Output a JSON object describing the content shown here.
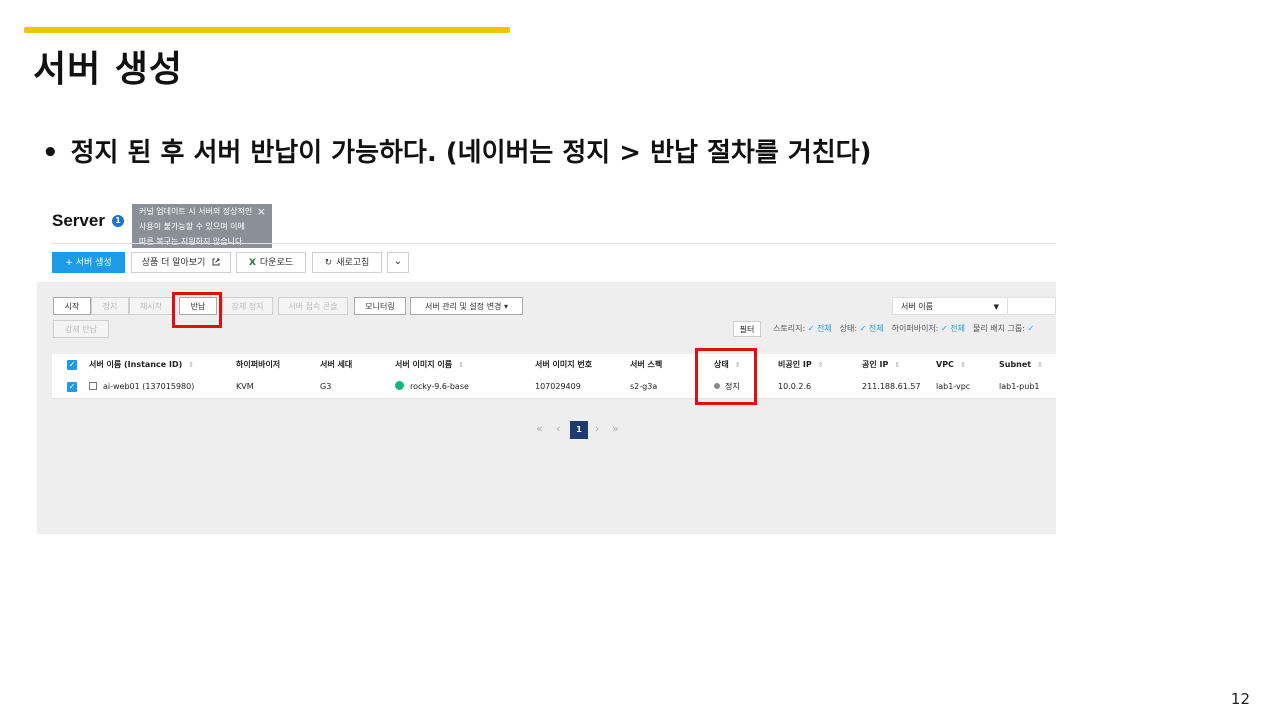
{
  "slide": {
    "title": "서버 생성",
    "bullet": "정지 된 후 서버 반납이 가능하다.  (네이버는 정지 > 반납 절차를 거친다)",
    "bullet_marker": "•",
    "page_number": "12",
    "accent_color": "#f5c400"
  },
  "console": {
    "title": "Server",
    "info_badge": "1",
    "tooltip": {
      "lines": [
        "커널 업데이트 시 서버의 정상적인",
        "사용이 불가능할 수 있으며 이에",
        "따른 복구는 지원하지 않습니다."
      ],
      "close": "×"
    },
    "toolbar": {
      "create": "+  서버 생성",
      "learn_more": "상품 더 알아보기",
      "learn_more_icon": "external-link-icon",
      "download_icon_text": "X",
      "download": "다운로드",
      "refresh_icon_text": "↻",
      "refresh": "새로고침",
      "more": "⌄"
    },
    "actions": {
      "start": "시작",
      "stop": "정지",
      "restart": "재시작",
      "return": "반납",
      "force_stop": "강제 정지",
      "connect_console": "서버 접속 콘솔",
      "monitoring": "모니터링",
      "manage": "서버 관리 및 설정 변경  ▾",
      "force_return": "강제 반납"
    },
    "search": {
      "select_label": "서버 이름",
      "caret": "▼"
    },
    "filter": {
      "button": "필터",
      "storage_label": "스토리지:",
      "storage_value": "전체",
      "status_label": "상태:",
      "status_value": "전체",
      "hypervisor_label": "하이퍼바이저:",
      "hypervisor_value": "전체",
      "placement_label": "물리 배치 그룹:",
      "check": "✓"
    },
    "table": {
      "headers": {
        "name": "서버 이름 (Instance ID)",
        "hypervisor": "하이퍼바이저",
        "generation": "서버 세대",
        "image_name": "서버 이미지 이름",
        "image_no": "서버 이미지 번호",
        "spec": "서버 스펙",
        "status": "상태",
        "private_ip": "비공인 IP",
        "public_ip": "공인 IP",
        "vpc": "VPC",
        "subnet": "Subnet"
      },
      "sort_glyph": "⇕",
      "rows": [
        {
          "name": "ai-web01 (137015980)",
          "hypervisor": "KVM",
          "generation": "G3",
          "image_name": "rocky-9.6-base",
          "image_no": "107029409",
          "spec": "s2-g3a",
          "status": "정지",
          "private_ip": "10.0.2.6",
          "public_ip": "211.188.61.57",
          "vpc": "lab1-vpc",
          "subnet": "lab1-pub1"
        }
      ]
    },
    "pagination": {
      "first": "«",
      "prev": "‹",
      "current": "1",
      "next": "›",
      "last": "»"
    },
    "highlight_color": "#e01010"
  }
}
